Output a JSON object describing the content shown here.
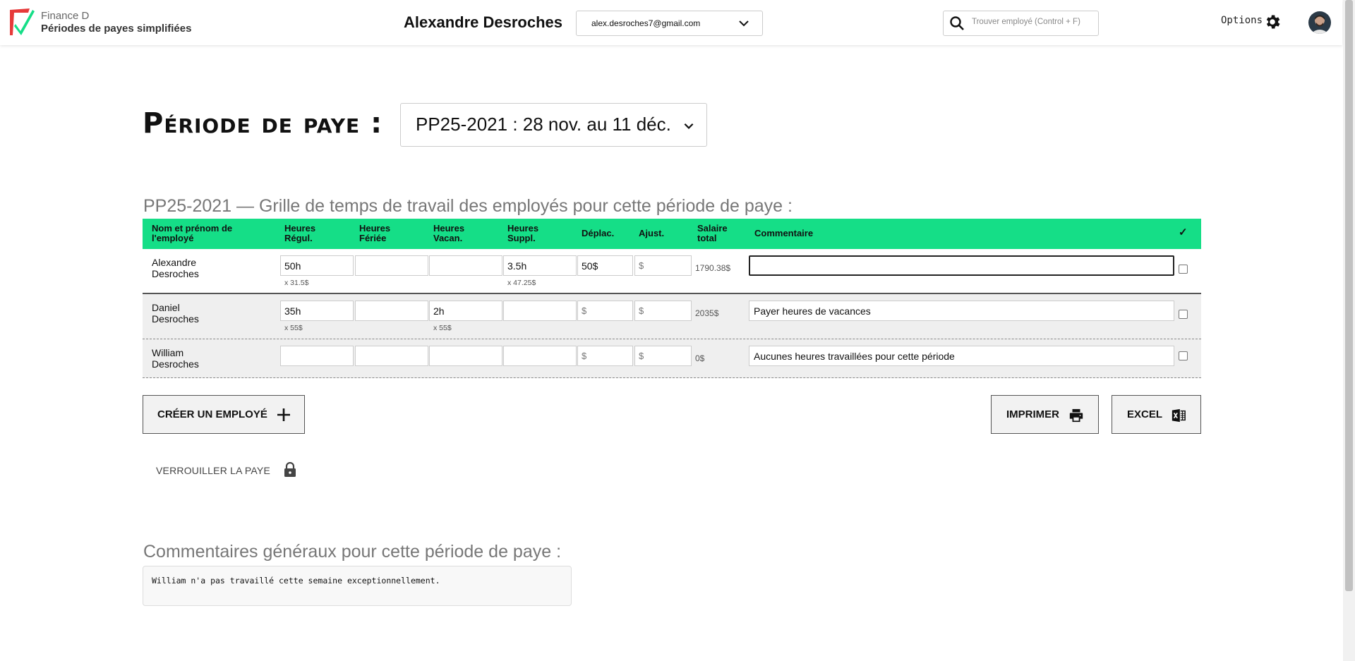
{
  "header": {
    "brand_small": "Finance D",
    "brand_big": "Périodes de payes simplifiées",
    "username": "Alexandre Desroches",
    "email": "alex.desroches7@gmail.com",
    "search_placeholder": "Trouver employé (Control + F)",
    "options_label": "Options",
    "colors": {
      "accent": "#15de87",
      "logo_red": "#e63a3a"
    }
  },
  "period": {
    "label": "Période de paye :",
    "selected": "PP25-2021 : 28 nov. au 11 déc."
  },
  "grid": {
    "title": "PP25-2021 — Grille de temps de travail des employés pour cette période de paye :",
    "columns": {
      "name": [
        "Nom et prénom de",
        "l'employé"
      ],
      "regular": [
        "Heures",
        "Régul."
      ],
      "holiday": [
        "Heures",
        "Fériée"
      ],
      "vacation": [
        "Heures",
        "Vacan."
      ],
      "overtime": [
        "Heures",
        "Suppl."
      ],
      "travel": "Déplac.",
      "adjust": "Ajust.",
      "salary": [
        "Salaire",
        "total"
      ],
      "comment": "Commentaire",
      "check": "✓"
    },
    "rows": [
      {
        "first": "Alexandre",
        "last": "Desroches",
        "regular": "50h",
        "regular_rate": "x 31.5$",
        "holiday": "",
        "vacation": "",
        "vacation_rate": "",
        "overtime": "3.5h",
        "overtime_rate": "x 47.25$",
        "travel": "50$",
        "adjust": "$",
        "total": "1790.38$",
        "comment": ""
      },
      {
        "first": "Daniel",
        "last": "Desroches",
        "regular": "35h",
        "regular_rate": "x 55$",
        "holiday": "",
        "vacation": "2h",
        "vacation_rate": "x 55$",
        "overtime": "",
        "overtime_rate": "",
        "travel": "$",
        "adjust": "$",
        "total": "2035$",
        "comment": "Payer heures de vacances"
      },
      {
        "first": "William",
        "last": "Desroches",
        "regular": "",
        "regular_rate": "",
        "holiday": "",
        "vacation": "",
        "vacation_rate": "",
        "overtime": "",
        "overtime_rate": "",
        "travel": "$",
        "adjust": "$",
        "total": "0$",
        "comment": "Aucunes heures travaillées pour cette période"
      }
    ]
  },
  "actions": {
    "create": "CRÉER UN EMPLOYÉ",
    "print": "IMPRIMER",
    "excel": "EXCEL",
    "lock": "VERROUILLER LA PAYE"
  },
  "general": {
    "title": "Commentaires généraux pour cette période de paye :",
    "text": "William n'a pas travaillé cette semaine exceptionnellement."
  }
}
